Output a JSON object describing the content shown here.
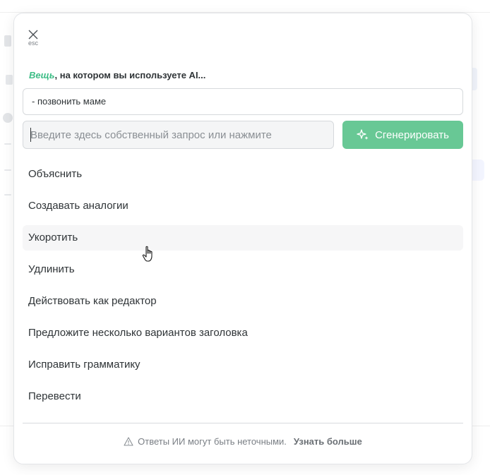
{
  "modal": {
    "close_hint": "esc",
    "context_title_accent": "Вещь",
    "context_title_rest": ", на котором вы используете AI...",
    "context_text": "- позвонить маме",
    "prompt_placeholder": "Введите здесь собственный запрос или нажмите",
    "generate_label": "Сгенерировать",
    "menu_items": [
      {
        "label": "Объяснить"
      },
      {
        "label": "Создавать аналогии"
      },
      {
        "label": "Укоротить"
      },
      {
        "label": "Удлинить"
      },
      {
        "label": "Действовать как редактор"
      },
      {
        "label": "Предложите несколько вариантов заголовка"
      },
      {
        "label": "Исправить грамматику"
      },
      {
        "label": "Перевести"
      }
    ],
    "hovered_item_index": 2,
    "footer_text": "Ответы ИИ могут быть неточными.",
    "footer_link": "Узнать больше"
  },
  "colors": {
    "accent": "#3dbd86",
    "generate_button": "#68c895"
  }
}
